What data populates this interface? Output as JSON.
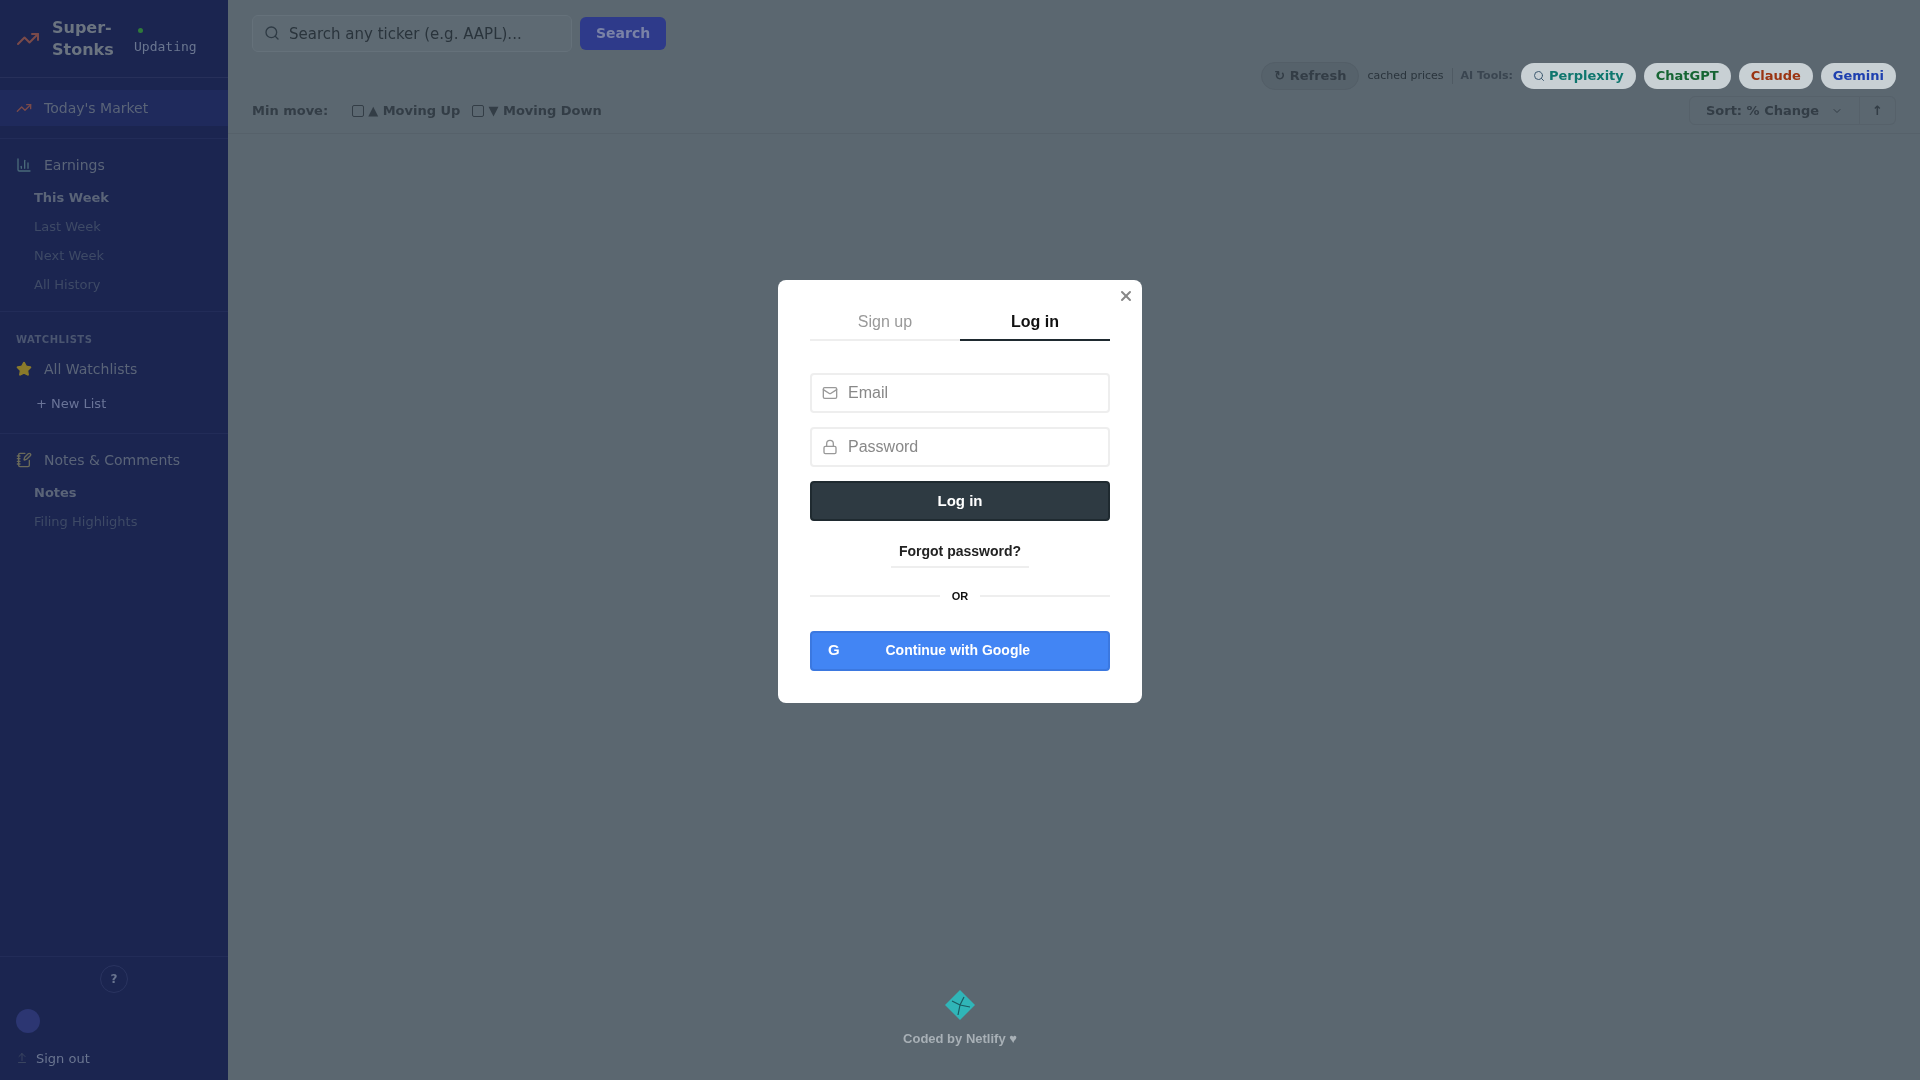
{
  "sidebar": {
    "logo": {
      "title": "Super-Stonks",
      "status": "Updating"
    },
    "sections": [
      {
        "label": "Today's Market",
        "selected": true
      },
      {
        "label": "Earnings",
        "selected": false,
        "children": [
          {
            "label": "This Week",
            "selected": true
          },
          {
            "label": "Last Week",
            "selected": false
          },
          {
            "label": "Next Week",
            "selected": false
          },
          {
            "label": "All History",
            "selected": false
          }
        ]
      },
      {
        "heading": "WATCHLISTS",
        "label": "All Watchlists",
        "selected": false,
        "action": "+ New List"
      },
      {
        "label": "Notes & Comments",
        "selected": false,
        "children": [
          {
            "label": "Notes",
            "selected": true
          },
          {
            "label": "Filing Highlights",
            "selected": false
          }
        ]
      }
    ],
    "help": "?",
    "sign_out": "Sign out"
  },
  "header": {
    "search": {
      "placeholder": "Search any ticker (e.g. AAPL)...",
      "button": "Search"
    },
    "refresh": "↻ Refresh",
    "cache_note": "cached prices",
    "ai_label": "AI Tools:",
    "ai_tools": [
      {
        "label": "Perplexity",
        "color": "#0f766e",
        "icon": true
      },
      {
        "label": "ChatGPT",
        "color": "#166534",
        "icon": false
      },
      {
        "label": "Claude",
        "color": "#9a3412",
        "icon": false
      },
      {
        "label": "Gemini",
        "color": "#1e40af",
        "icon": false
      }
    ],
    "filters": {
      "label": "Min move:",
      "options": [
        {
          "label": "▲ Moving Up",
          "checked": false
        },
        {
          "label": "▼ Moving Down",
          "checked": false
        }
      ]
    },
    "sort": {
      "value": "Sort: % Change",
      "direction": "↑"
    }
  },
  "modal": {
    "tabs": [
      {
        "label": "Sign up",
        "selected": false
      },
      {
        "label": "Log in",
        "selected": true
      }
    ],
    "email": {
      "placeholder": "Email"
    },
    "password": {
      "placeholder": "Password"
    },
    "submit": "Log in",
    "forgot": "Forgot password?",
    "divider": "OR",
    "google": "Continue with Google",
    "google_letter": "G"
  },
  "footer": {
    "text": "Coded by Netlify ♥"
  }
}
